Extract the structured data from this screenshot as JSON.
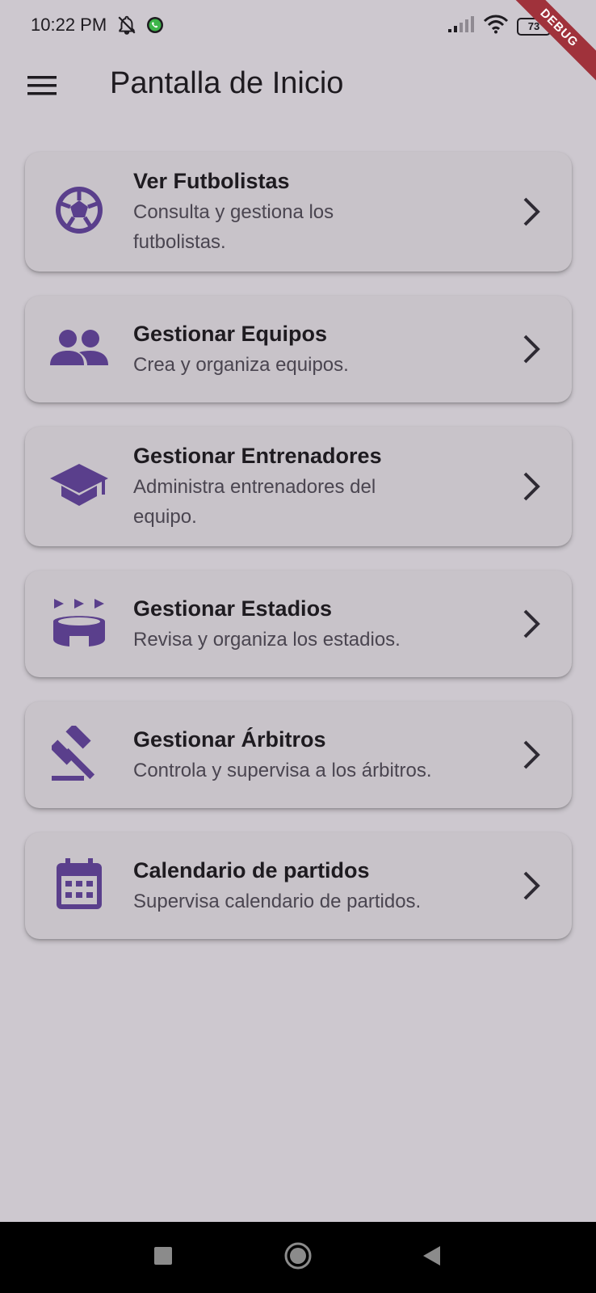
{
  "status_bar": {
    "time": "10:22 PM",
    "battery_level": "73"
  },
  "debug_banner": "DEBUG",
  "app_bar": {
    "title": "Pantalla de Inicio",
    "menu_icon": "hamburger-menu-icon"
  },
  "menu_items": [
    {
      "title": "Ver Futbolistas",
      "subtitle": "Consulta y gestiona los futbolistas.",
      "icon": "soccer-ball-icon"
    },
    {
      "title": "Gestionar Equipos",
      "subtitle": "Crea y organiza equipos.",
      "icon": "people-icon"
    },
    {
      "title": "Gestionar Entrenadores",
      "subtitle": "Administra entrenadores del equipo.",
      "icon": "graduation-cap-icon"
    },
    {
      "title": "Gestionar Estadios",
      "subtitle": "Revisa y organiza los estadios.",
      "icon": "stadium-icon"
    },
    {
      "title": "Gestionar Árbitros",
      "subtitle": "Controla y supervisa a los árbitros.",
      "icon": "gavel-icon"
    },
    {
      "title": "Calendario de partidos",
      "subtitle": "Supervisa calendario de partidos.",
      "icon": "calendar-icon"
    }
  ],
  "colors": {
    "background": "#cdc8cf",
    "card": "#c8c3c9",
    "accent": "#5a3f8c",
    "text": "#1e1b20",
    "subtext": "#4a4550"
  }
}
